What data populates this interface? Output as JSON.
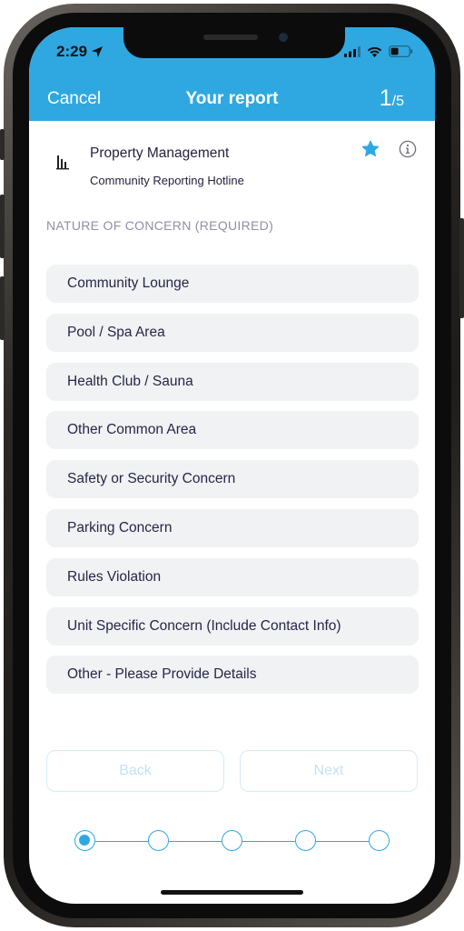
{
  "status_bar": {
    "time": "2:29"
  },
  "header": {
    "cancel_label": "Cancel",
    "title": "Your report",
    "step_current": "1",
    "step_separator": "/",
    "step_total": "5"
  },
  "organization": {
    "name": "Property Management",
    "subtitle": "Community Reporting Hotline",
    "favorite_icon": "star-icon",
    "info_icon": "info-icon"
  },
  "section": {
    "label": "NATURE OF CONCERN (REQUIRED)"
  },
  "options": [
    "Community Lounge",
    "Pool / Spa Area",
    "Health Club / Sauna",
    "Other Common Area",
    "Safety or Security Concern",
    "Parking Concern",
    "Rules Violation",
    "Unit Specific Concern (Include Contact Info)",
    "Other - Please Provide Details"
  ],
  "navigation": {
    "back_label": "Back",
    "next_label": "Next"
  },
  "progress": {
    "current_step": 1,
    "total_steps": 5
  },
  "colors": {
    "accent": "#2fa8e2",
    "option_background": "#f0f2f3",
    "text": "#262649",
    "muted_label": "#8f8fa7",
    "disabled_button_text": "#c3e2f4"
  }
}
